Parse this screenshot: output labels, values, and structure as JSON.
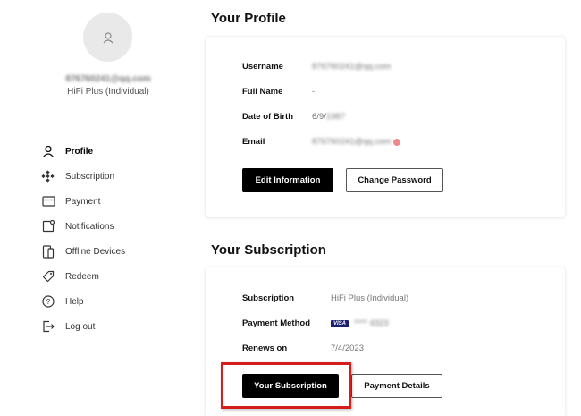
{
  "user": {
    "email": "876760241@qq.com",
    "plan": "HiFi Plus (Individual)"
  },
  "nav": {
    "items": [
      {
        "label": "Profile",
        "icon": "user-icon"
      },
      {
        "label": "Subscription",
        "icon": "dots-icon"
      },
      {
        "label": "Payment",
        "icon": "card-icon"
      },
      {
        "label": "Notifications",
        "icon": "bell-square-icon"
      },
      {
        "label": "Offline Devices",
        "icon": "devices-icon"
      },
      {
        "label": "Redeem",
        "icon": "tag-icon"
      },
      {
        "label": "Help",
        "icon": "help-icon"
      },
      {
        "label": "Log out",
        "icon": "logout-icon"
      }
    ],
    "active": "Profile"
  },
  "profile": {
    "title": "Your Profile",
    "username_label": "Username",
    "username_value": "876760241@qq.com",
    "fullname_label": "Full Name",
    "fullname_value": "-",
    "dob_label": "Date of Birth",
    "dob_value": "6/9/",
    "dob_year": "1987",
    "email_label": "Email",
    "email_value": "876760241@qq.com",
    "edit_button": "Edit Information",
    "change_password_button": "Change Password"
  },
  "subscription": {
    "title": "Your Subscription",
    "subscription_label": "Subscription",
    "subscription_value": "HiFi Plus (Individual)",
    "payment_label": "Payment Method",
    "card_brand": "VISA",
    "card_number": "**** 4323",
    "renews_label": "Renews on",
    "renews_value": "7/4/2023",
    "your_subscription_button": "Your Subscription",
    "payment_details_button": "Payment Details"
  },
  "colors": {
    "highlight": "#d61c1c",
    "primary_button": "#000000",
    "visa": "#1a1f71"
  }
}
